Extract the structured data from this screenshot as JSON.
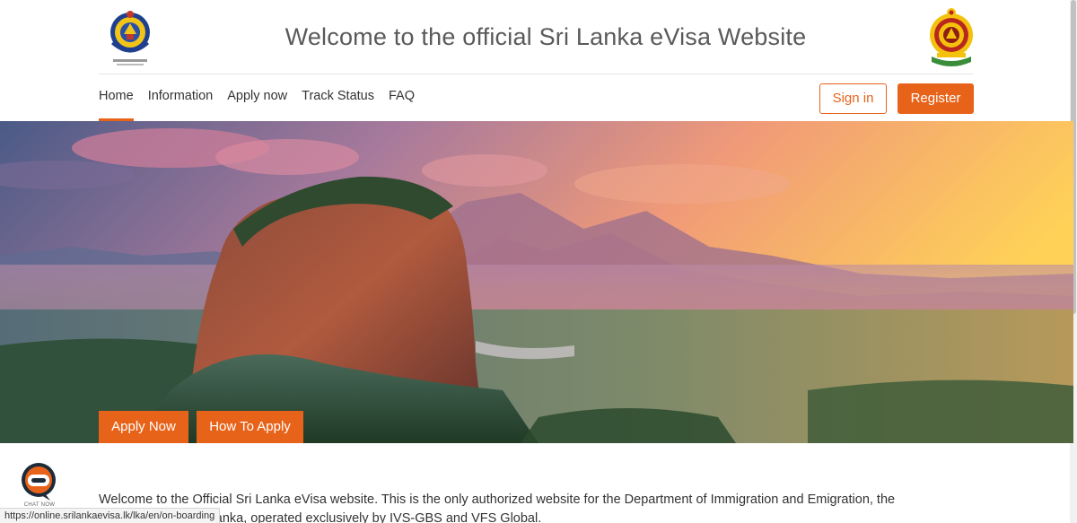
{
  "header": {
    "title": "Welcome to the official Sri Lanka eVisa Website",
    "left_emblem_icon": "immigration-department-emblem-icon",
    "right_emblem_icon": "sri-lanka-national-emblem-icon"
  },
  "nav": {
    "items": [
      {
        "label": "Home",
        "active": true
      },
      {
        "label": "Information",
        "active": false
      },
      {
        "label": "Apply now",
        "active": false
      },
      {
        "label": "Track Status",
        "active": false
      },
      {
        "label": "FAQ",
        "active": false
      }
    ],
    "signin_label": "Sign in",
    "register_label": "Register"
  },
  "hero": {
    "apply_now_label": "Apply Now",
    "how_to_apply_label": "How To Apply"
  },
  "chat": {
    "icon": "chat-bubble-icon",
    "label": "CHAT NOW"
  },
  "intro": {
    "text": "Welcome to the Official Sri Lanka eVisa website. This is the only authorized website for the Department of Immigration and Emigration, the Government of Sri Lanka, operated exclusively by IVS-GBS and VFS Global."
  },
  "status_bar": {
    "url": "https://online.srilankaevisa.lk/lka/en/on-boarding"
  },
  "colors": {
    "accent": "#e8631a",
    "title": "#5a5a5a",
    "text": "#333333"
  }
}
